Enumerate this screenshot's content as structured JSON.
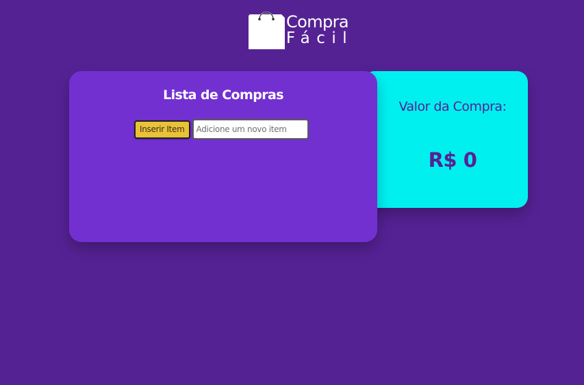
{
  "brand": {
    "line1": "Compra",
    "line2": "Fácil",
    "logo_icon": "shopping-bag-icon"
  },
  "list": {
    "title": "Lista de Compras",
    "insert_button_label": "Inserir Item",
    "input_placeholder": "Adicione um novo item",
    "input_value": ""
  },
  "total": {
    "label": "Valor da Compra:",
    "value": "R$ 0"
  },
  "colors": {
    "background": "#552294",
    "list_card": "#7330d1",
    "total_card": "#00f0f0",
    "button": "#e9c235",
    "text_dark_purple": "#552294"
  }
}
